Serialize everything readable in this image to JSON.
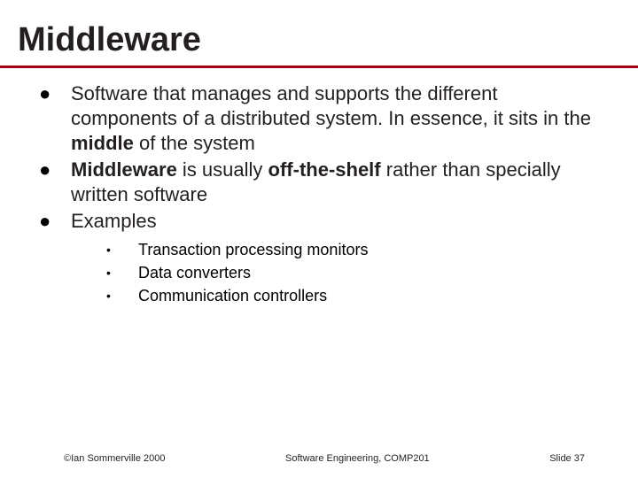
{
  "title": "Middleware",
  "bullets": {
    "b1_pre": "Software that manages and supports the different components of a distributed system. In essence, it sits in the ",
    "b1_bold": "middle",
    "b1_post": " of the system",
    "b2_bold1": "Middleware",
    "b2_mid": " is usually ",
    "b2_bold2": "off-the-shelf",
    "b2_post": " rather than specially written software",
    "b3": "Examples"
  },
  "sub": {
    "s1": "Transaction processing monitors",
    "s2": "Data converters",
    "s3": "Communication controllers"
  },
  "footer": {
    "left": "©Ian Sommerville 2000",
    "center": "Software Engineering, COMP201",
    "right": "Slide 37"
  }
}
